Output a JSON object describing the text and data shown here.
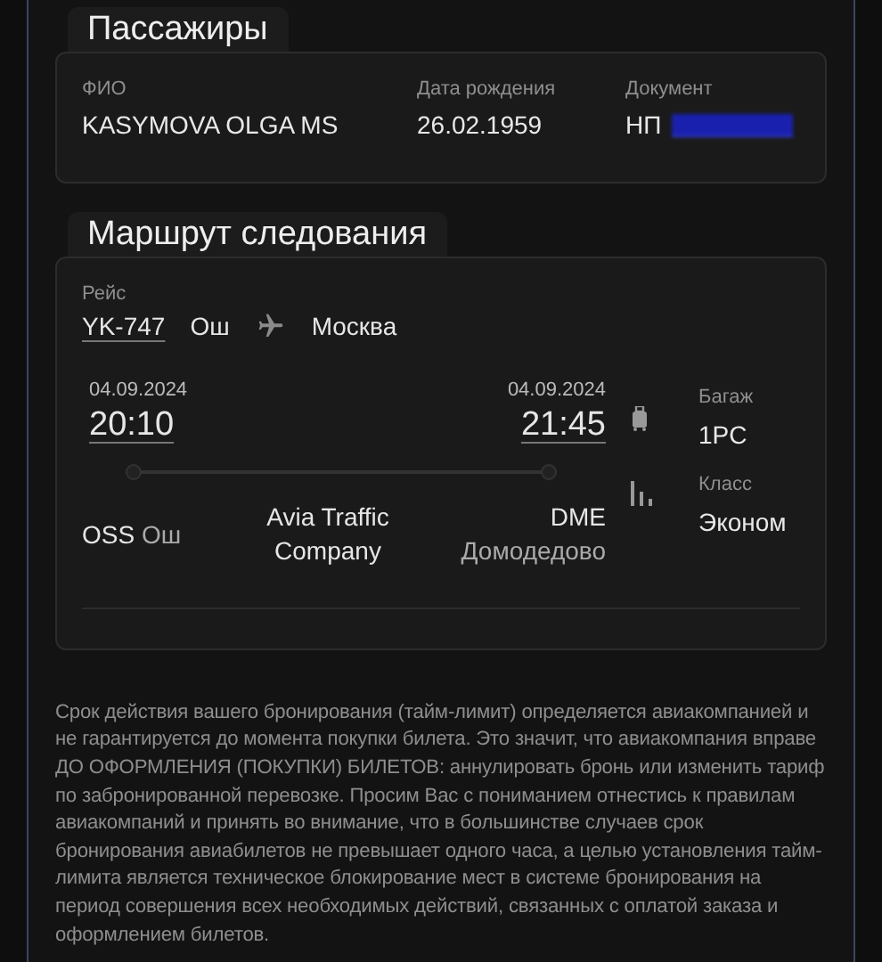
{
  "passengers": {
    "title": "Пассажиры",
    "columns": [
      {
        "label": "ФИО",
        "value": "KASYMOVA OLGA MS"
      },
      {
        "label": "Дата рождения",
        "value": "26.02.1959"
      },
      {
        "label": "Документ",
        "value": "НП",
        "link_redacted": true
      }
    ]
  },
  "route": {
    "title": "Маршрут следования",
    "flight_label": "Рейс",
    "flight_number": "YK-747",
    "from_city": "Ош",
    "to_city": "Москва",
    "departure": {
      "date": "04.09.2024",
      "time": "20:10",
      "code": "OSS",
      "airport": "Ош"
    },
    "carrier": "Avia Traffic Company",
    "arrival": {
      "date": "04.09.2024",
      "time": "21:45",
      "code": "DME",
      "airport": "Домодедово"
    },
    "baggage": {
      "label": "Багаж",
      "value": "1PC"
    },
    "class": {
      "label": "Класс",
      "value": "Эконом"
    }
  },
  "notice": "Срок действия вашего бронирования (тайм-лимит) определяется авиакомпанией и не гарантируется до момента покупки билета. Это значит, что авиакомпания вправе ДО ОФОРМЛЕНИЯ (ПОКУПКИ) БИЛЕТОВ: аннулировать бронь или изменить тариф по забронированной перевозке. Просим Вас с пониманием отнестись к правилам авиакомпаний и принять во внимание, что в большинстве случаев срок бронирования авиабилетов не превышает одного часа, а целью установления тайм-лимита является техническое блокирование мест в системе бронирования на период совершения всех необходимых действий, связанных с оплатой заказа и оформлением билетов."
}
